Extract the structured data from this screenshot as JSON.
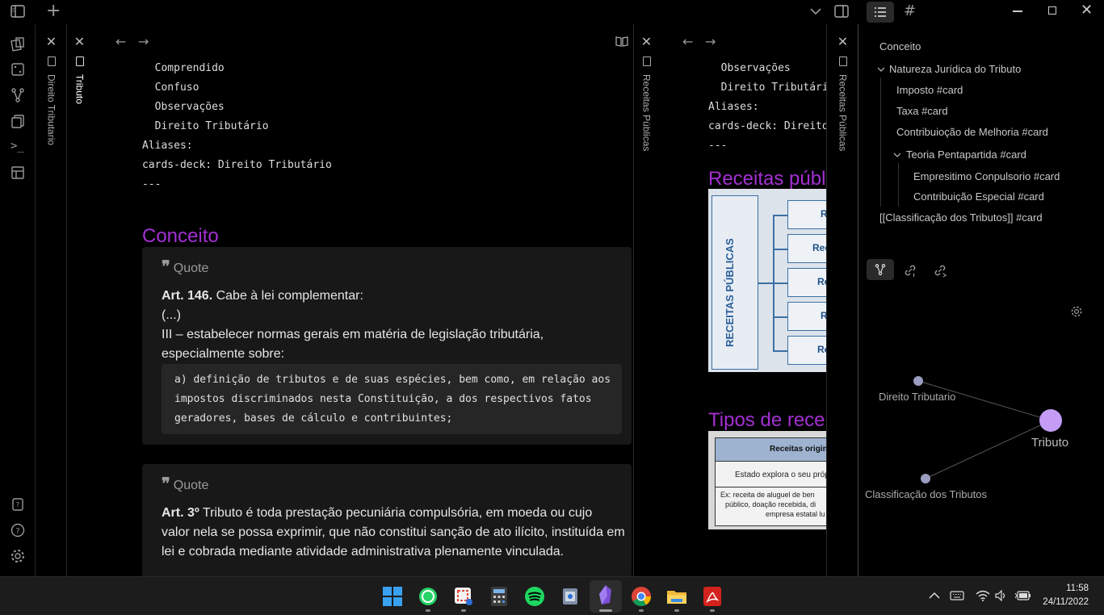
{
  "spines": {
    "direito_tributario": "Direito Tributario",
    "tributo": "Tributo",
    "receitas_publicas_1": "Receitas Públicas",
    "receitas_publicas_2": "Receitas Públicas"
  },
  "note1": {
    "yaml": [
      "  Comprendido",
      "  Confuso",
      "  Observações",
      "  Direito Tributário",
      "Aliases:",
      "cards-deck: Direito Tributário",
      "---"
    ],
    "heading": "Conceito",
    "callout1": {
      "title": "Quote",
      "bold": "Art. 146.",
      "line1": " Cabe à lei complementar:",
      "line2": "(...)",
      "line3": "III – estabelecer normas gerais em matéria de legislação tributária,",
      "line4": "especialmente sobre:",
      "code": [
        "a) definição de tributos e de suas espécies, bem como, em relação aos",
        "impostos discriminados nesta Constituição, a dos respectivos fatos",
        "geradores, bases de cálculo e contribuintes;"
      ]
    },
    "callout2": {
      "title": "Quote",
      "bold": "Art. 3º",
      "line1": " Tributo é toda prestação pecuniária compulsória, em moeda ou cujo",
      "line2": "valor nela se possa exprimir, que não constitui sanção de ato ilícito, instituída em",
      "line3": "lei e cobrada mediante atividade administrativa plenamente vinculada."
    }
  },
  "note2": {
    "yaml": [
      "  Observações",
      "  Direito Tributário",
      "Aliases:",
      "cards-deck: Direito Tributário",
      "---"
    ],
    "heading1": "Receitas públicas",
    "image1_label": "RECEITAS PÚBLICAS",
    "image1_rows": [
      "R",
      "Rec",
      "Re",
      "R",
      "Re"
    ],
    "heading2": "Tipos de receitas",
    "table_header": "Receitas originá",
    "table_row1": "Estado explora o seu próp",
    "table_row2a": "Ex: receita de aluguel de ben",
    "table_row2b": "público, doação recebida, di",
    "table_row2c": "empresa estatal lu"
  },
  "outline": {
    "items": [
      {
        "label": "Conceito"
      },
      {
        "label": "Natureza Jurídica do Tributo"
      },
      {
        "label": "Imposto #card"
      },
      {
        "label": "Taxa #card"
      },
      {
        "label": "Contribuioção de Melhoria #card"
      },
      {
        "label": "Teoria Pentapartida #card"
      },
      {
        "label": "Empresitimo Conpulsorio #card"
      },
      {
        "label": "Contribuição Especial #card"
      },
      {
        "label": "[[Classificação dos Tributos]] #card"
      }
    ]
  },
  "graph": {
    "nodes": [
      {
        "label": "Direito Tributario"
      },
      {
        "label": "Tributo"
      },
      {
        "label": "Classificação dos Tributos"
      }
    ],
    "accent": "#c49cf5"
  },
  "taskbar": {
    "time": "11:58",
    "date": "24/11/2022"
  }
}
